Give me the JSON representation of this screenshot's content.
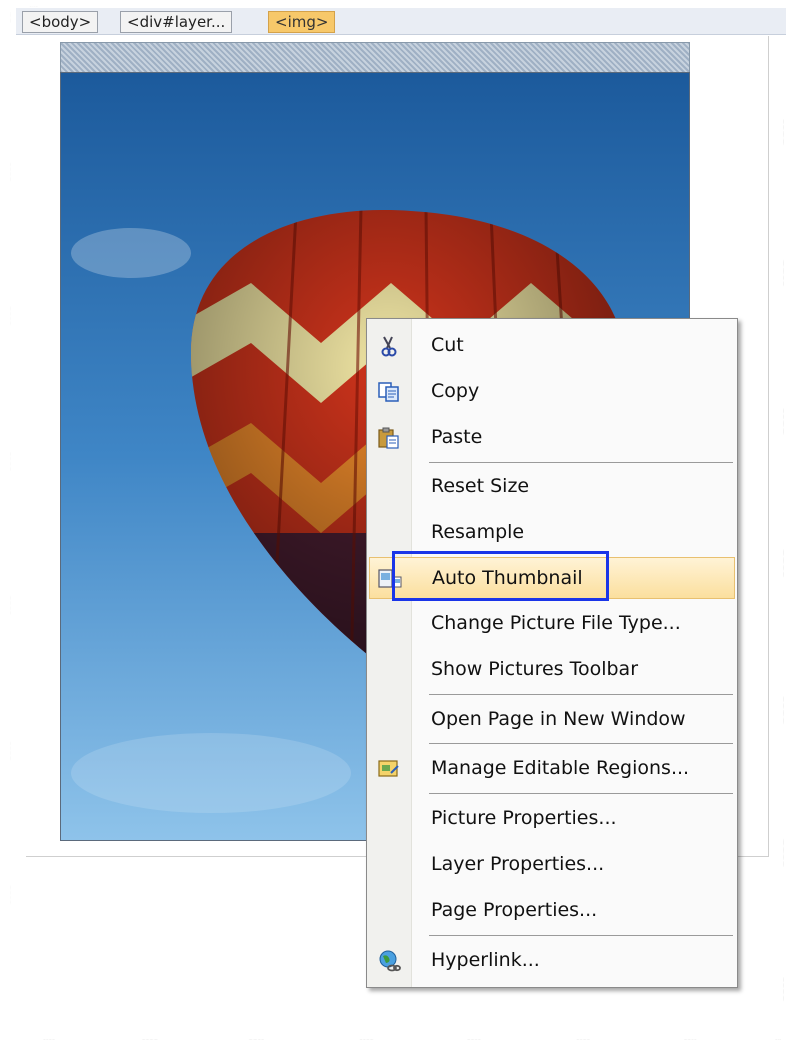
{
  "tag_selector": {
    "tags": [
      "<body>",
      "<div#layer...",
      "<img>"
    ]
  },
  "context_menu": {
    "items": [
      {
        "label": "Cut",
        "icon": "scissors-icon"
      },
      {
        "label": "Copy",
        "icon": "copy-icon"
      },
      {
        "label": "Paste",
        "icon": "clipboard-icon"
      },
      {
        "label": "Reset Size"
      },
      {
        "label": "Resample"
      },
      {
        "label": "Auto Thumbnail",
        "icon": "thumbnail-icon",
        "highlighted": true
      },
      {
        "label": "Change Picture File Type..."
      },
      {
        "label": "Show Pictures Toolbar"
      },
      {
        "label": "Open Page in New Window"
      },
      {
        "label": "Manage Editable Regions...",
        "icon": "regions-icon"
      },
      {
        "label": "Picture Properties..."
      },
      {
        "label": "Layer Properties..."
      },
      {
        "label": "Page Properties..."
      },
      {
        "label": "Hyperlink...",
        "icon": "globe-link-icon"
      }
    ]
  },
  "colors": {
    "highlight_border": "#1a35e8",
    "menu_hover": "#fbdf9e",
    "active_tag": "#f7c86a"
  }
}
